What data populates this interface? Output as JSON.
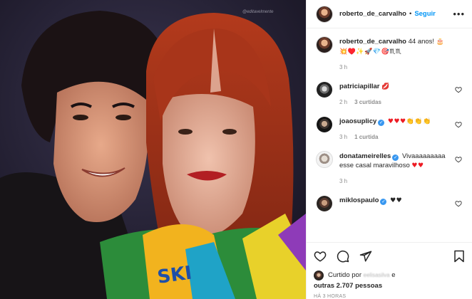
{
  "header": {
    "username": "roberto_de_carvalho",
    "separator": "•",
    "follow_label": "Seguir",
    "more_glyph": "•••"
  },
  "comments": [
    {
      "avatar": "roberto-avatar",
      "username": "roberto_de_carvalho",
      "text": "44 anos!",
      "emoji_line": "🎂💥♥️✨🚀💎🎯♏♏",
      "time": "3 h",
      "likes_label": ""
    },
    {
      "avatar": "patricia-avatar",
      "username": "patriciapillar",
      "text": "",
      "emoji": "💋",
      "time": "2 h",
      "likes_label": "3 curtidas"
    },
    {
      "avatar": "joao-avatar",
      "username": "joaosuplicy",
      "verified": true,
      "emoji": "♥♥♥👏👏👏",
      "time": "3 h",
      "likes_label": "1 curtida"
    },
    {
      "avatar": "dona-avatar",
      "username": "donatameirelles",
      "verified": true,
      "text": "Vivaaaaaaaaa esse casal maravilhoso",
      "emoji": "♥♥",
      "time": "3 h",
      "likes_label": ""
    },
    {
      "avatar": "miklos-avatar",
      "username": "miklospaulo",
      "verified": true,
      "emoji": "♥♥",
      "time": "",
      "likes_label": ""
    }
  ],
  "likes": {
    "liked_by_prefix": "Curtido por",
    "liked_by_user": "eelisasilva",
    "conjunction": "e",
    "others_label": "outras 2.707 pessoas"
  },
  "post_time": "HÁ 3 HORAS",
  "photo": {
    "watermark": "@editavelmente"
  },
  "colors": {
    "accent": "#0095f6",
    "verified": "#3897f0",
    "text": "#262626",
    "muted": "#8e8e8e",
    "heart": "#ed1c24"
  }
}
